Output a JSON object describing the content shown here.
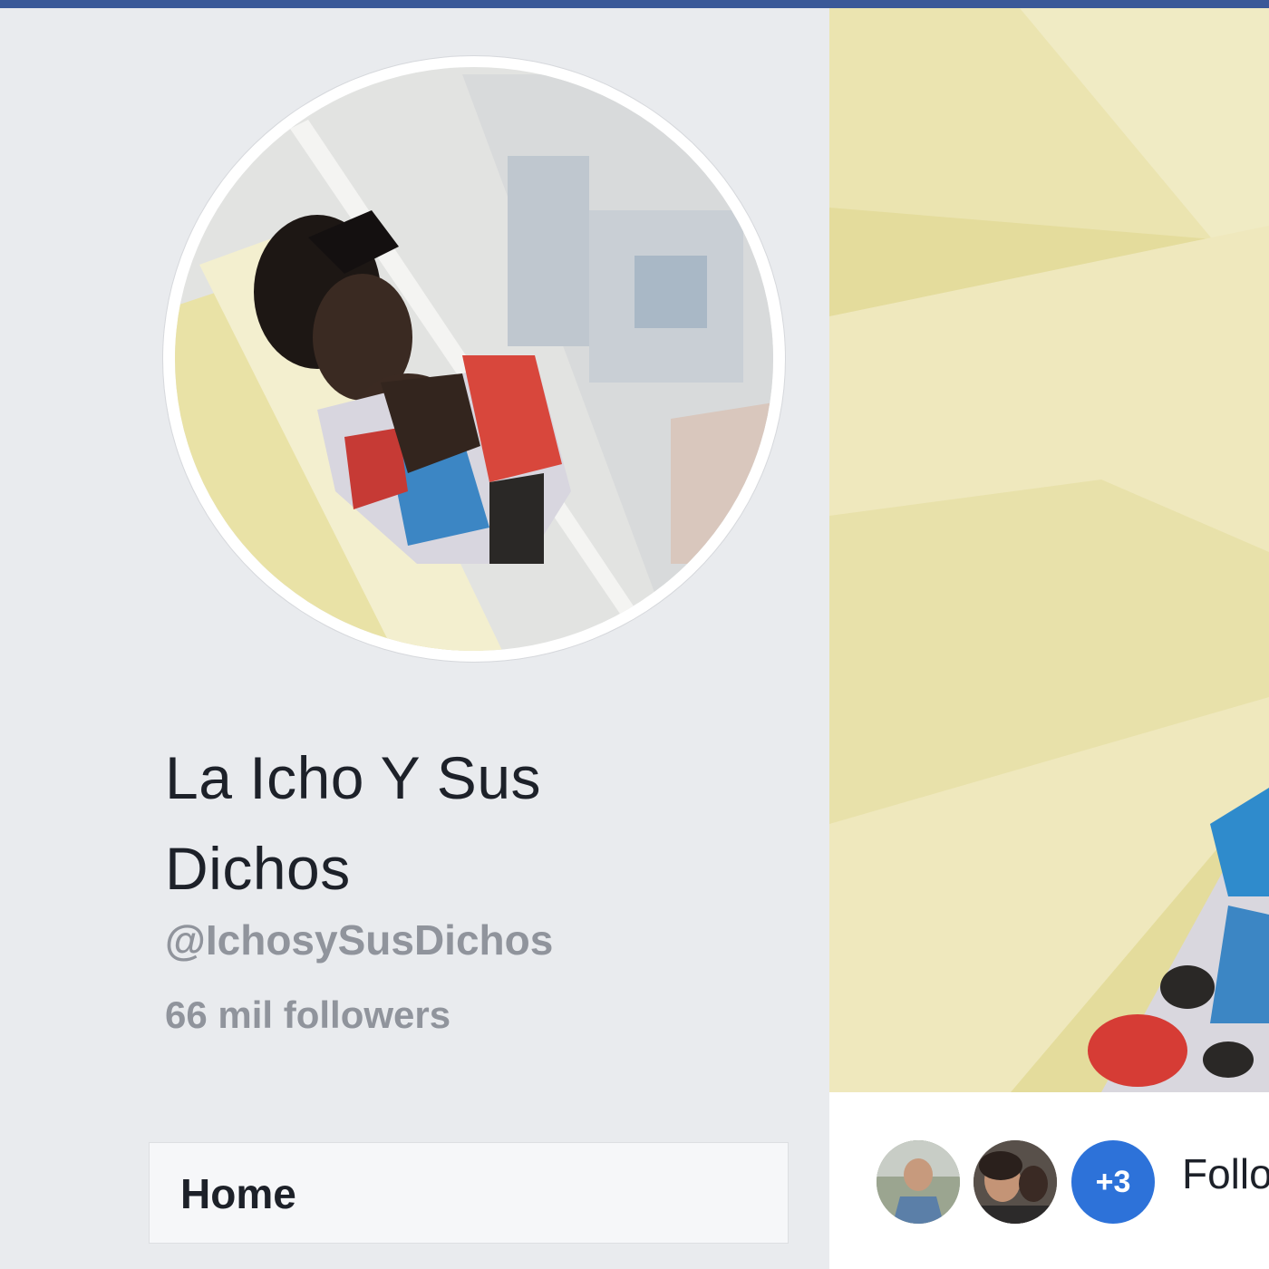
{
  "colors": {
    "top_bar": "#3b5998",
    "background": "#e9ebee",
    "muted_text": "#90949c",
    "badge_blue": "#2d72d9"
  },
  "profile": {
    "picture_icon": "profile-photo",
    "name_line_1": "La Icho Y Sus",
    "name_line_2": "Dichos",
    "handle": "@IchosySusDichos",
    "followers": "66 mil followers"
  },
  "nav": {
    "home_label": "Home"
  },
  "cover": {
    "picture_icon": "cover-photo"
  },
  "social": {
    "more_count": "+3",
    "follow_label": "Follo"
  }
}
